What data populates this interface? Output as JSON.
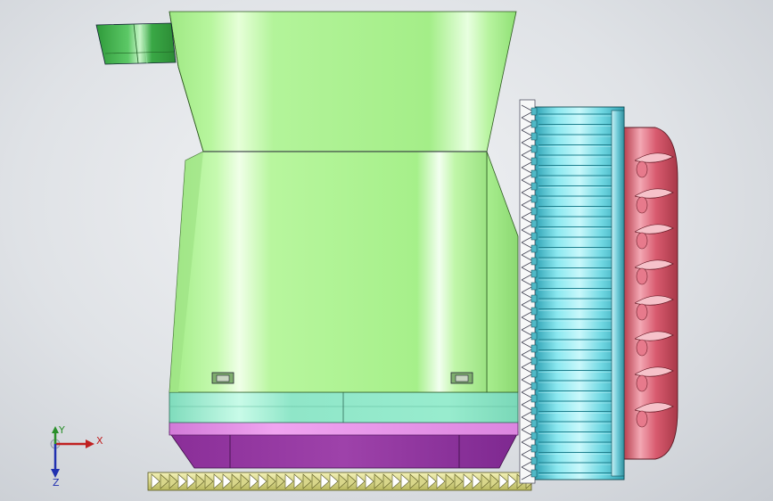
{
  "app": {
    "view": "cad-3d-viewport"
  },
  "triad": {
    "x_label": "X",
    "y_label": "Y",
    "z_label": "Z"
  },
  "colors": {
    "body_green": "#a8f08a",
    "body_green_highlight": "#e6ffd8",
    "body_green_shadow": "#6fc95a",
    "handle_green": "#2f9a3a",
    "band_cyan": "#8fe6c8",
    "base_purple": "#9a3aa6",
    "base_purple_top": "#e48ae8",
    "fan_cyan": "#6fd7e2",
    "fan_cyan_dark": "#2f9fb0",
    "motor_red": "#d85a6e",
    "motor_red_light": "#f3a8b4",
    "gear_yellow": "#e6e49a",
    "gear_white": "#ffffff",
    "axis_x": "#c02020",
    "axis_y": "#2a8f2a",
    "axis_z": "#2030b0"
  },
  "model": {
    "parts": [
      "upper-hopper",
      "lower-housing",
      "handle-bracket",
      "cyan-band",
      "purple-base",
      "fan-wheel",
      "motor-cap",
      "gear-rack"
    ]
  }
}
